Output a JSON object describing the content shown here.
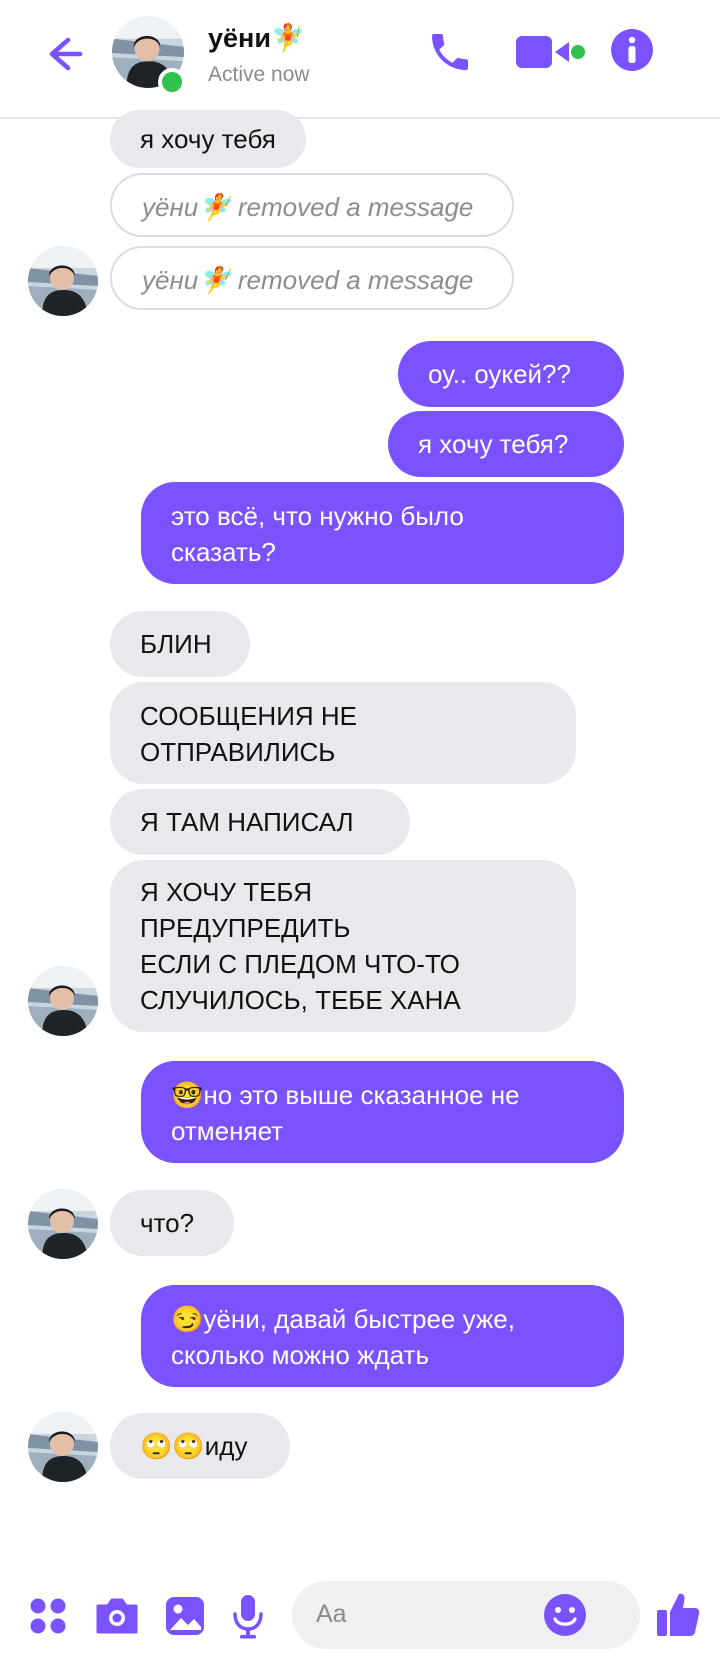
{
  "header": {
    "name": "уёни🧚",
    "status": "Active now"
  },
  "messages": [
    {
      "side": "in",
      "text": "я хочу тебя"
    },
    {
      "side": "removed",
      "name": "уёни",
      "emoji": "🧚",
      "text": " removed a message"
    },
    {
      "side": "removed",
      "name": "уёни",
      "emoji": "🧚",
      "text": " removed a message"
    },
    {
      "side": "out",
      "text": "оу.. оукей??"
    },
    {
      "side": "out",
      "text": "я хочу тебя?"
    },
    {
      "side": "out",
      "line1": "это всё, что нужно было",
      "line2": "сказать?"
    },
    {
      "side": "in",
      "text": "БЛИН"
    },
    {
      "side": "in",
      "line1": "СООБЩЕНИЯ НЕ",
      "line2": "ОТПРАВИЛИСЬ"
    },
    {
      "side": "in",
      "text": "Я ТАМ НАПИСАЛ"
    },
    {
      "side": "in",
      "line1": "Я ХОЧУ ТЕБЯ",
      "line2": "ПРЕДУПРЕДИТЬ",
      "line3": "ЕСЛИ С ПЛЕДОМ ЧТО-ТО",
      "line4": "СЛУЧИЛОСЬ, ТЕБЕ ХАНА"
    },
    {
      "side": "out",
      "line1": "🤓но это выше сказанное не",
      "line2": "отменяет"
    },
    {
      "side": "in",
      "text": "что?"
    },
    {
      "side": "out",
      "line1": "😏уёни, давай быстрее уже,",
      "line2": "сколько можно ждать"
    },
    {
      "side": "in",
      "text": "🙄🙄иду"
    }
  ],
  "composer": {
    "placeholder": "Aa"
  },
  "colors": {
    "accent": "#7b52ff",
    "incoming_bg": "#e9e8ec",
    "online": "#31c24d"
  },
  "icons": [
    "back-arrow-icon",
    "phone-icon",
    "video-camera-icon",
    "info-icon",
    "apps-icon",
    "camera-icon",
    "gallery-icon",
    "microphone-icon",
    "emoji-icon",
    "thumbs-up-icon"
  ]
}
